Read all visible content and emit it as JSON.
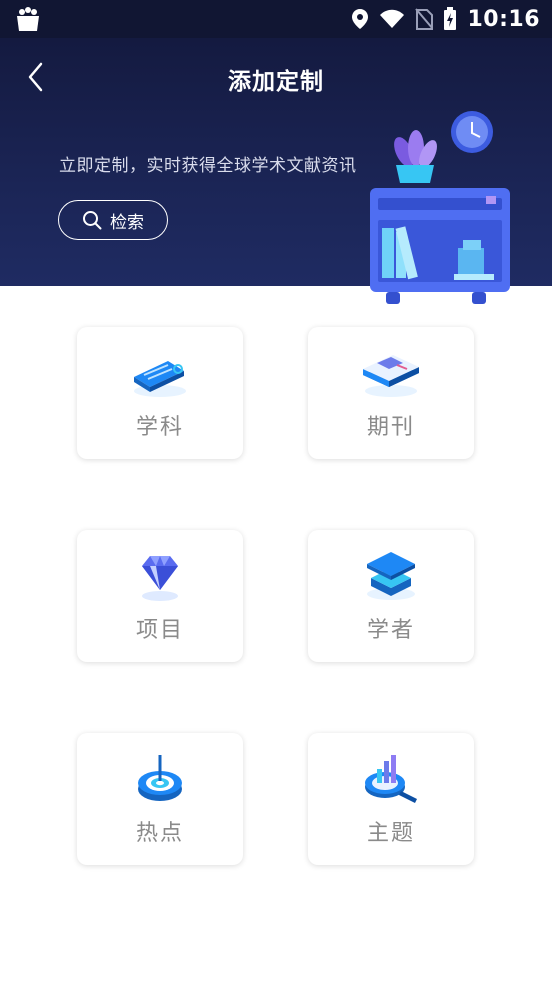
{
  "status_bar": {
    "time": "10:16",
    "icons": [
      "shopping-bag-icon",
      "location-icon",
      "wifi-icon",
      "no-sim-icon",
      "battery-charging-icon"
    ]
  },
  "header": {
    "title": "添加定制",
    "slogan": "立即定制，实时获得全球学术文献资讯",
    "search_label": "检索",
    "background_color": "#1b2556"
  },
  "categories": [
    {
      "label": "学科",
      "icon": "tag-icon"
    },
    {
      "label": "期刊",
      "icon": "book-icon"
    },
    {
      "label": "项目",
      "icon": "diamond-icon"
    },
    {
      "label": "学者",
      "icon": "graduation-cap-icon"
    },
    {
      "label": "热点",
      "icon": "target-icon"
    },
    {
      "label": "主题",
      "icon": "magnifier-chart-icon"
    }
  ],
  "accent_color": "#1e88f5"
}
